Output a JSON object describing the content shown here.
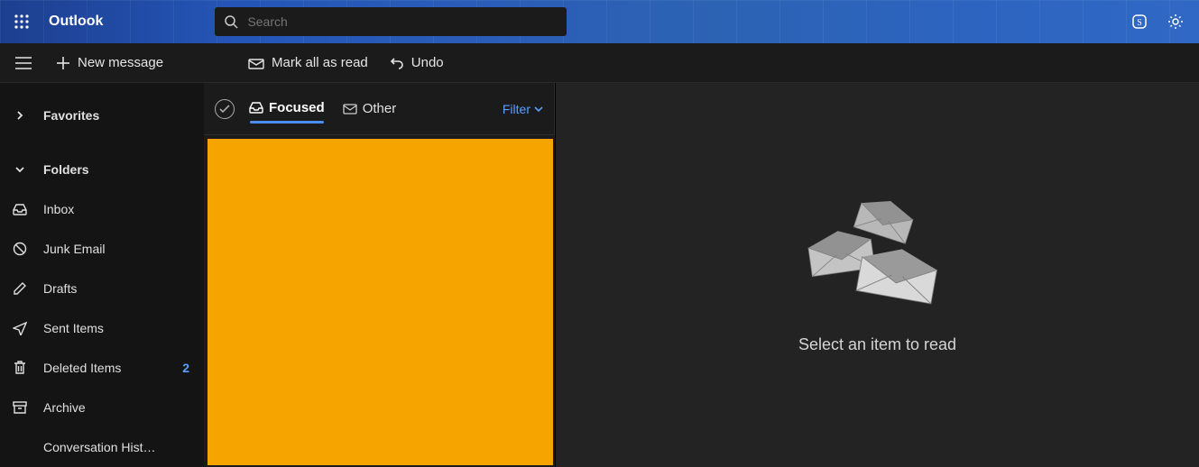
{
  "header": {
    "app_title": "Outlook",
    "search_placeholder": "Search"
  },
  "toolbar": {
    "new_message": "New message",
    "mark_all_read": "Mark all as read",
    "undo": "Undo"
  },
  "sidebar": {
    "favorites_label": "Favorites",
    "folders_label": "Folders",
    "items": [
      {
        "label": "Inbox",
        "icon": "inbox",
        "count": ""
      },
      {
        "label": "Junk Email",
        "icon": "junk",
        "count": ""
      },
      {
        "label": "Drafts",
        "icon": "drafts",
        "count": ""
      },
      {
        "label": "Sent Items",
        "icon": "sent",
        "count": ""
      },
      {
        "label": "Deleted Items",
        "icon": "deleted",
        "count": "2"
      },
      {
        "label": "Archive",
        "icon": "archive",
        "count": ""
      },
      {
        "label": "Conversation Hist…",
        "icon": "none",
        "count": ""
      }
    ]
  },
  "msglist": {
    "focused_label": "Focused",
    "other_label": "Other",
    "filter_label": "Filter"
  },
  "reading_pane": {
    "empty_text": "Select an item to read"
  }
}
